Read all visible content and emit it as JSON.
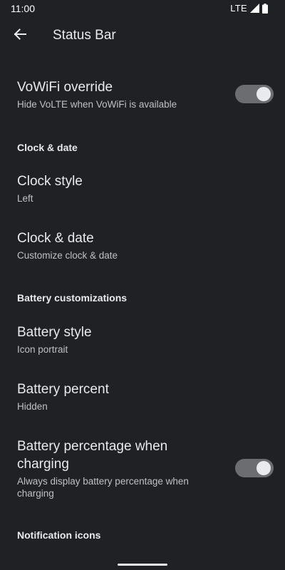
{
  "status_bar": {
    "time": "11:00",
    "network": "LTE"
  },
  "app_bar": {
    "title": "Status Bar"
  },
  "items": {
    "vowifi": {
      "title": "VoWiFi override",
      "summary": "Hide VoLTE when VoWiFi is available",
      "toggle_on": true
    },
    "clock_style": {
      "title": "Clock style",
      "summary": "Left"
    },
    "clock_date": {
      "title": "Clock & date",
      "summary": "Customize clock & date"
    },
    "battery_style": {
      "title": "Battery style",
      "summary": "Icon portrait"
    },
    "battery_percent": {
      "title": "Battery percent",
      "summary": "Hidden"
    },
    "battery_charging": {
      "title_line1": "Battery percentage when",
      "title_line2": "charging",
      "summary_line1": "Always display battery percentage when",
      "summary_line2": "charging",
      "toggle_on": true
    }
  },
  "sections": {
    "clock_date": "Clock & date",
    "battery": "Battery customizations",
    "notification_icons": "Notification icons"
  },
  "colors": {
    "background": "#202124",
    "text_primary": "#e8eaed",
    "text_secondary": "#bdc1c6",
    "toggle_track": "#6b6d70"
  }
}
